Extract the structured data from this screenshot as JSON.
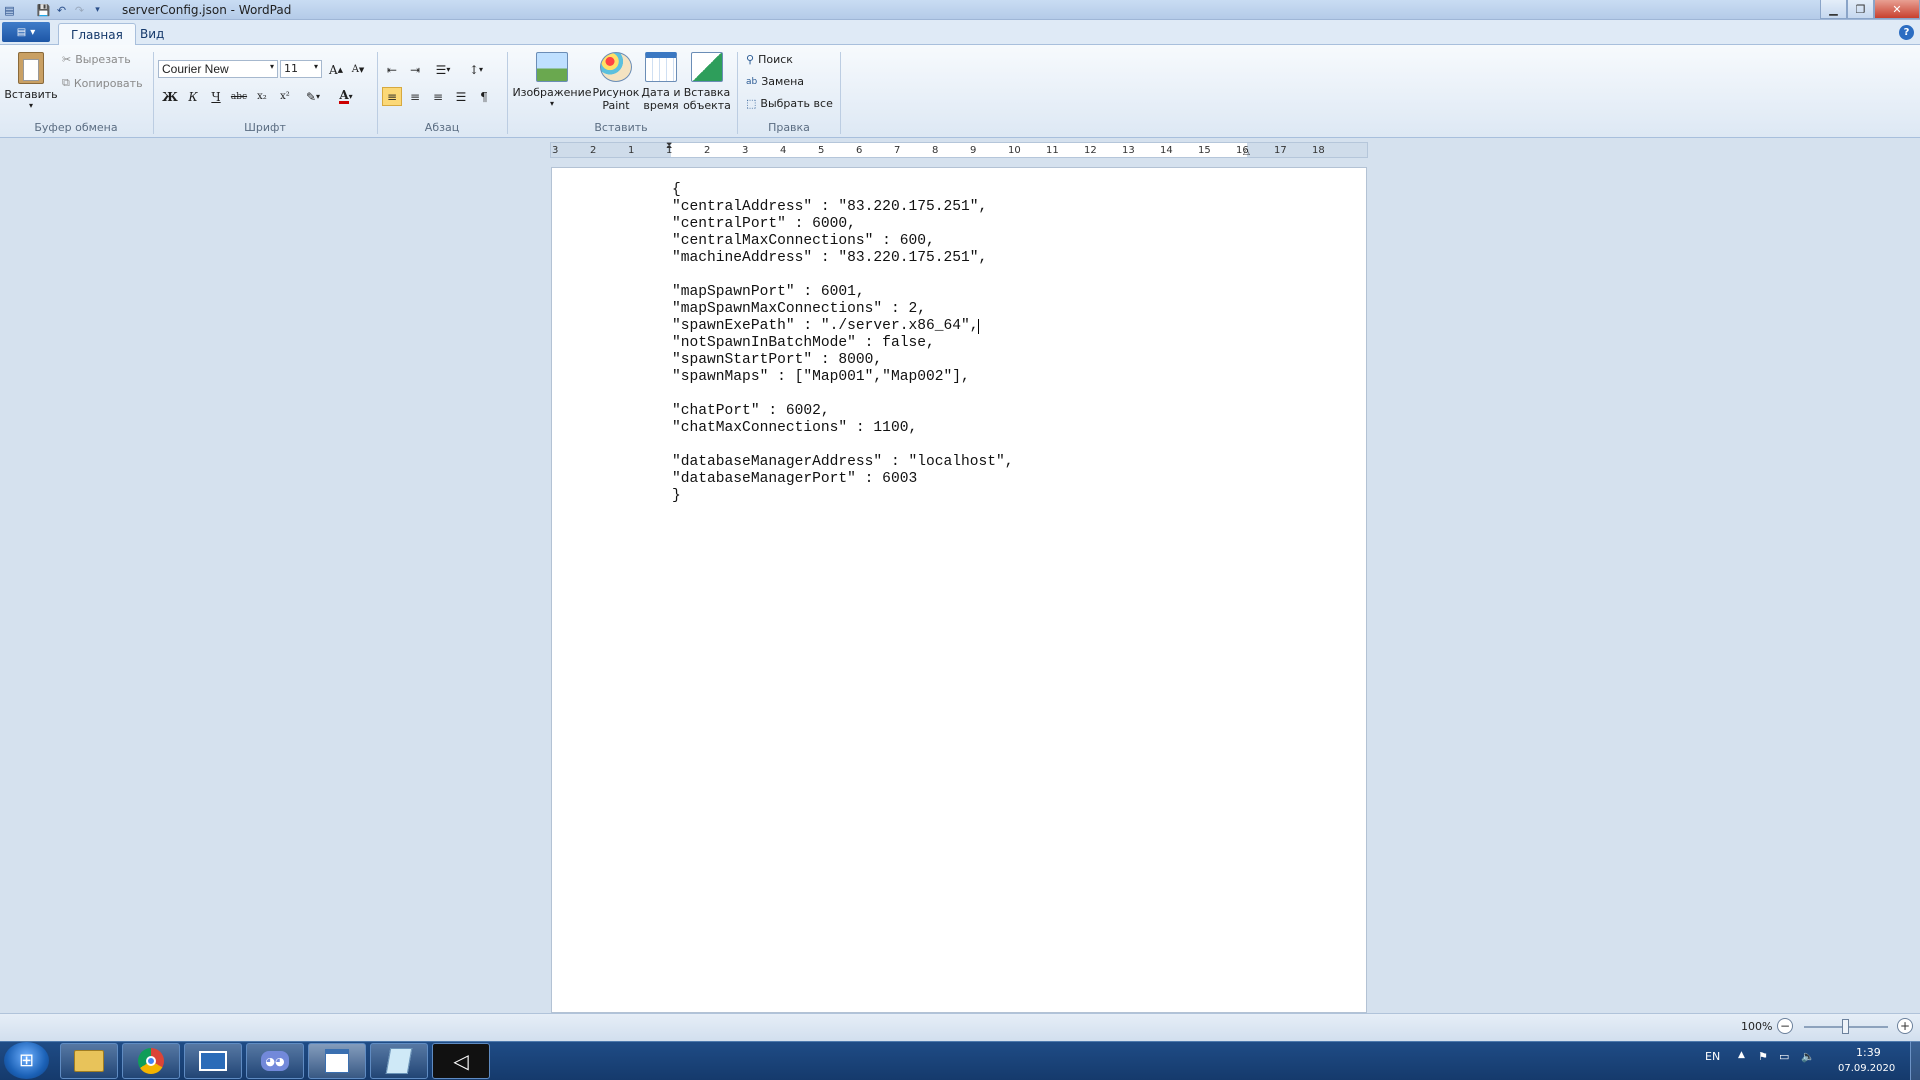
{
  "window": {
    "title": "serverConfig.json - WordPad"
  },
  "tabs": [
    {
      "label": "Главная",
      "active": true
    },
    {
      "label": "Вид",
      "active": false
    }
  ],
  "ribbon": {
    "clipboard": {
      "paste_label": "Вставить",
      "cut_label": "Вырезать",
      "copy_label": "Копировать",
      "group_label": "Буфер обмена"
    },
    "font": {
      "family": "Courier New",
      "size": "11",
      "group_label": "Шрифт",
      "bold": "Ж",
      "italic": "К",
      "underline": "Ч",
      "strike": "abc",
      "subscript": "x₂",
      "superscript": "x²"
    },
    "paragraph": {
      "group_label": "Абзац"
    },
    "insert": {
      "group_label": "Вставить",
      "picture_label": "Изображение",
      "paint_label_1": "Рисунок",
      "paint_label_2": "Paint",
      "datetime_label_1": "Дата и",
      "datetime_label_2": "время",
      "object_label_1": "Вставка",
      "object_label_2": "объекта"
    },
    "editing": {
      "group_label": "Правка",
      "find_label": "Поиск",
      "replace_label": "Замена",
      "select_all_label": "Выбрать все"
    }
  },
  "ruler": {
    "ticks": [
      "3",
      "2",
      "1",
      "1",
      "2",
      "3",
      "4",
      "5",
      "6",
      "7",
      "8",
      "9",
      "10",
      "11",
      "12",
      "13",
      "14",
      "15",
      "16",
      "17",
      "18"
    ]
  },
  "document": {
    "lines": [
      "{",
      "\"centralAddress\" : \"83.220.175.251\",",
      "\"centralPort\" : 6000,",
      "\"centralMaxConnections\" : 600,",
      "\"machineAddress\" : \"83.220.175.251\",",
      "",
      "\"mapSpawnPort\" : 6001,",
      "\"mapSpawnMaxConnections\" : 2,",
      "\"spawnExePath\" : \"./server.x86_64\",",
      "\"notSpawnInBatchMode\" : false,",
      "\"spawnStartPort\" : 8000,",
      "\"spawnMaps\" : [\"Map001\",\"Map002\"],",
      "",
      "\"chatPort\" : 6002,",
      "\"chatMaxConnections\" : 1100,",
      "",
      "\"databaseManagerAddress\" : \"localhost\",",
      "\"databaseManagerPort\" : 6003",
      "}"
    ]
  },
  "status": {
    "zoom": "100%"
  },
  "taskbar": {
    "apps": [
      "file-explorer-icon",
      "chrome-icon",
      "remote-desktop-icon",
      "discord-icon",
      "wordpad-icon",
      "notepad-icon",
      "unity-icon"
    ],
    "lang": "EN",
    "time": "1:39",
    "date": "07.09.2020"
  },
  "colors": {
    "accent": "#1d56a6",
    "selected_button": "#fbd877",
    "taskbar": "#153a6c"
  }
}
